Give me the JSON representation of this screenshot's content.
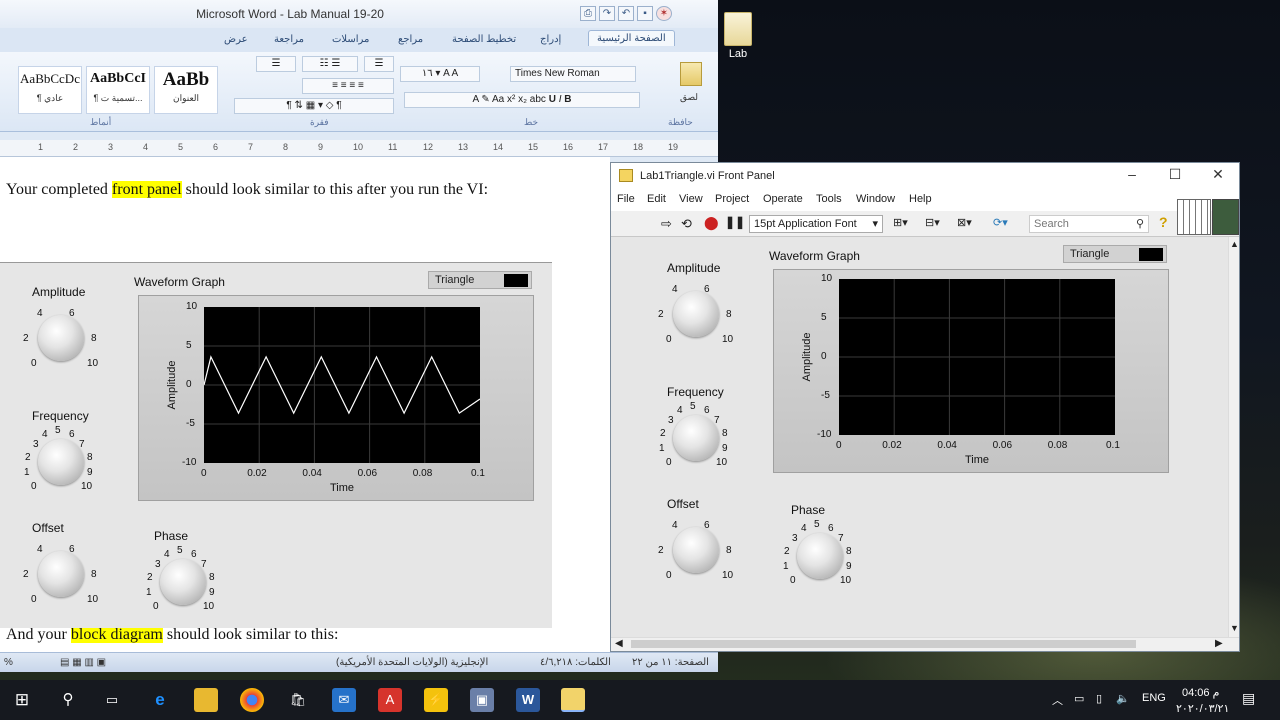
{
  "desktop": {
    "folder_label": "Lab"
  },
  "word": {
    "title": "Microsoft Word - Lab Manual 19-20",
    "tabs": [
      "الصفحة الرئيسية",
      "إدراج",
      "تخطيط الصفحة",
      "مراجع",
      "مراسلات",
      "مراجعة",
      "عرض"
    ],
    "styles": [
      {
        "preview": "AaBbCcDc",
        "name": "¶ عادي"
      },
      {
        "preview": "AaBbCcI",
        "name": "¶ تسمية ت..."
      },
      {
        "preview": "AaBb",
        "name": "العنوان"
      }
    ],
    "font_name": "Times New Roman",
    "font_size": "١٦",
    "group_labels": [
      "أنماط",
      "فقرة",
      "خط",
      "حافظة"
    ],
    "paste_label": "لصق",
    "ruler_numbers": [
      "1",
      "2",
      "3",
      "4",
      "5",
      "6",
      "7",
      "8",
      "9",
      "10",
      "11",
      "12",
      "13",
      "14",
      "15",
      "16",
      "17",
      "18",
      "19"
    ],
    "doc": {
      "line1_pre": "Your completed ",
      "line1_hl": "front panel",
      "line1_post": " should look similar to this after you run the VI:",
      "line2_pre": "And your ",
      "line2_hl": "block diagram",
      "line2_post": " should look similar to this:"
    },
    "status": {
      "page": "الصفحة: ١١ من ٢٢",
      "words": "الكلمات: ٤/٦,٢١٨",
      "language": "الإنجليزية (الولايات المتحدة الأمريكية)",
      "zoom": "%"
    }
  },
  "doc_front_panel": {
    "knobs": [
      {
        "label": "Amplitude",
        "ticks": [
          "4",
          "6",
          "2",
          "8",
          "0",
          "10"
        ]
      },
      {
        "label": "Frequency",
        "ticks": [
          "4",
          "5",
          "6",
          "3",
          "7",
          "2",
          "8",
          "1",
          "9",
          "0",
          "10"
        ]
      },
      {
        "label": "Offset",
        "ticks": [
          "4",
          "6",
          "2",
          "8",
          "0",
          "10"
        ]
      },
      {
        "label": "Phase",
        "ticks": [
          "4",
          "5",
          "6",
          "3",
          "7",
          "2",
          "8",
          "1",
          "9",
          "0",
          "10"
        ]
      }
    ],
    "graph": {
      "title": "Waveform Graph",
      "legend": "Triangle",
      "ylabel": "Amplitude",
      "xlabel": "Time",
      "yticks": [
        "10",
        "5",
        "0",
        "-5",
        "-10"
      ],
      "xticks": [
        "0",
        "0.02",
        "0.04",
        "0.06",
        "0.08",
        "0.1"
      ]
    }
  },
  "labview": {
    "title": "Lab1Triangle.vi Front Panel",
    "menu": [
      "File",
      "Edit",
      "View",
      "Project",
      "Operate",
      "Tools",
      "Window",
      "Help"
    ],
    "font_select": "15pt Application Font",
    "search_placeholder": "Search",
    "knobs": [
      {
        "label": "Amplitude",
        "ticks": [
          "4",
          "6",
          "2",
          "8",
          "0",
          "10"
        ]
      },
      {
        "label": "Frequency",
        "ticks": [
          "4",
          "5",
          "6",
          "3",
          "7",
          "2",
          "8",
          "1",
          "9",
          "0",
          "10"
        ]
      },
      {
        "label": "Offset",
        "ticks": [
          "4",
          "6",
          "2",
          "8",
          "0",
          "10"
        ]
      },
      {
        "label": "Phase",
        "ticks": [
          "4",
          "5",
          "6",
          "3",
          "7",
          "2",
          "8",
          "1",
          "9",
          "0",
          "10"
        ]
      }
    ],
    "graph": {
      "title": "Waveform Graph",
      "legend": "Triangle",
      "ylabel": "Amplitude",
      "xlabel": "Time",
      "yticks": [
        "10",
        "5",
        "0",
        "-5",
        "-10"
      ],
      "xticks": [
        "0",
        "0.02",
        "0.04",
        "0.06",
        "0.08",
        "0.1"
      ]
    }
  },
  "chart_data": {
    "type": "line",
    "title": "Waveform Graph",
    "xlabel": "Time",
    "ylabel": "Amplitude",
    "xlim": [
      0,
      0.1
    ],
    "ylim": [
      -10,
      10
    ],
    "series": [
      {
        "name": "Triangle",
        "x": [
          0,
          0.0025,
          0.0125,
          0.0225,
          0.0325,
          0.0425,
          0.0525,
          0.0625,
          0.0725,
          0.0825,
          0.0925,
          0.1
        ],
        "y": [
          0,
          3.6,
          -3.6,
          3.6,
          -3.6,
          3.6,
          -3.6,
          3.6,
          -3.6,
          3.6,
          -3.6,
          -1.8
        ]
      }
    ]
  },
  "taskbar": {
    "language": "ENG",
    "time": "04:06 م",
    "date": "٢٠٢٠/٠٣/٢١"
  }
}
